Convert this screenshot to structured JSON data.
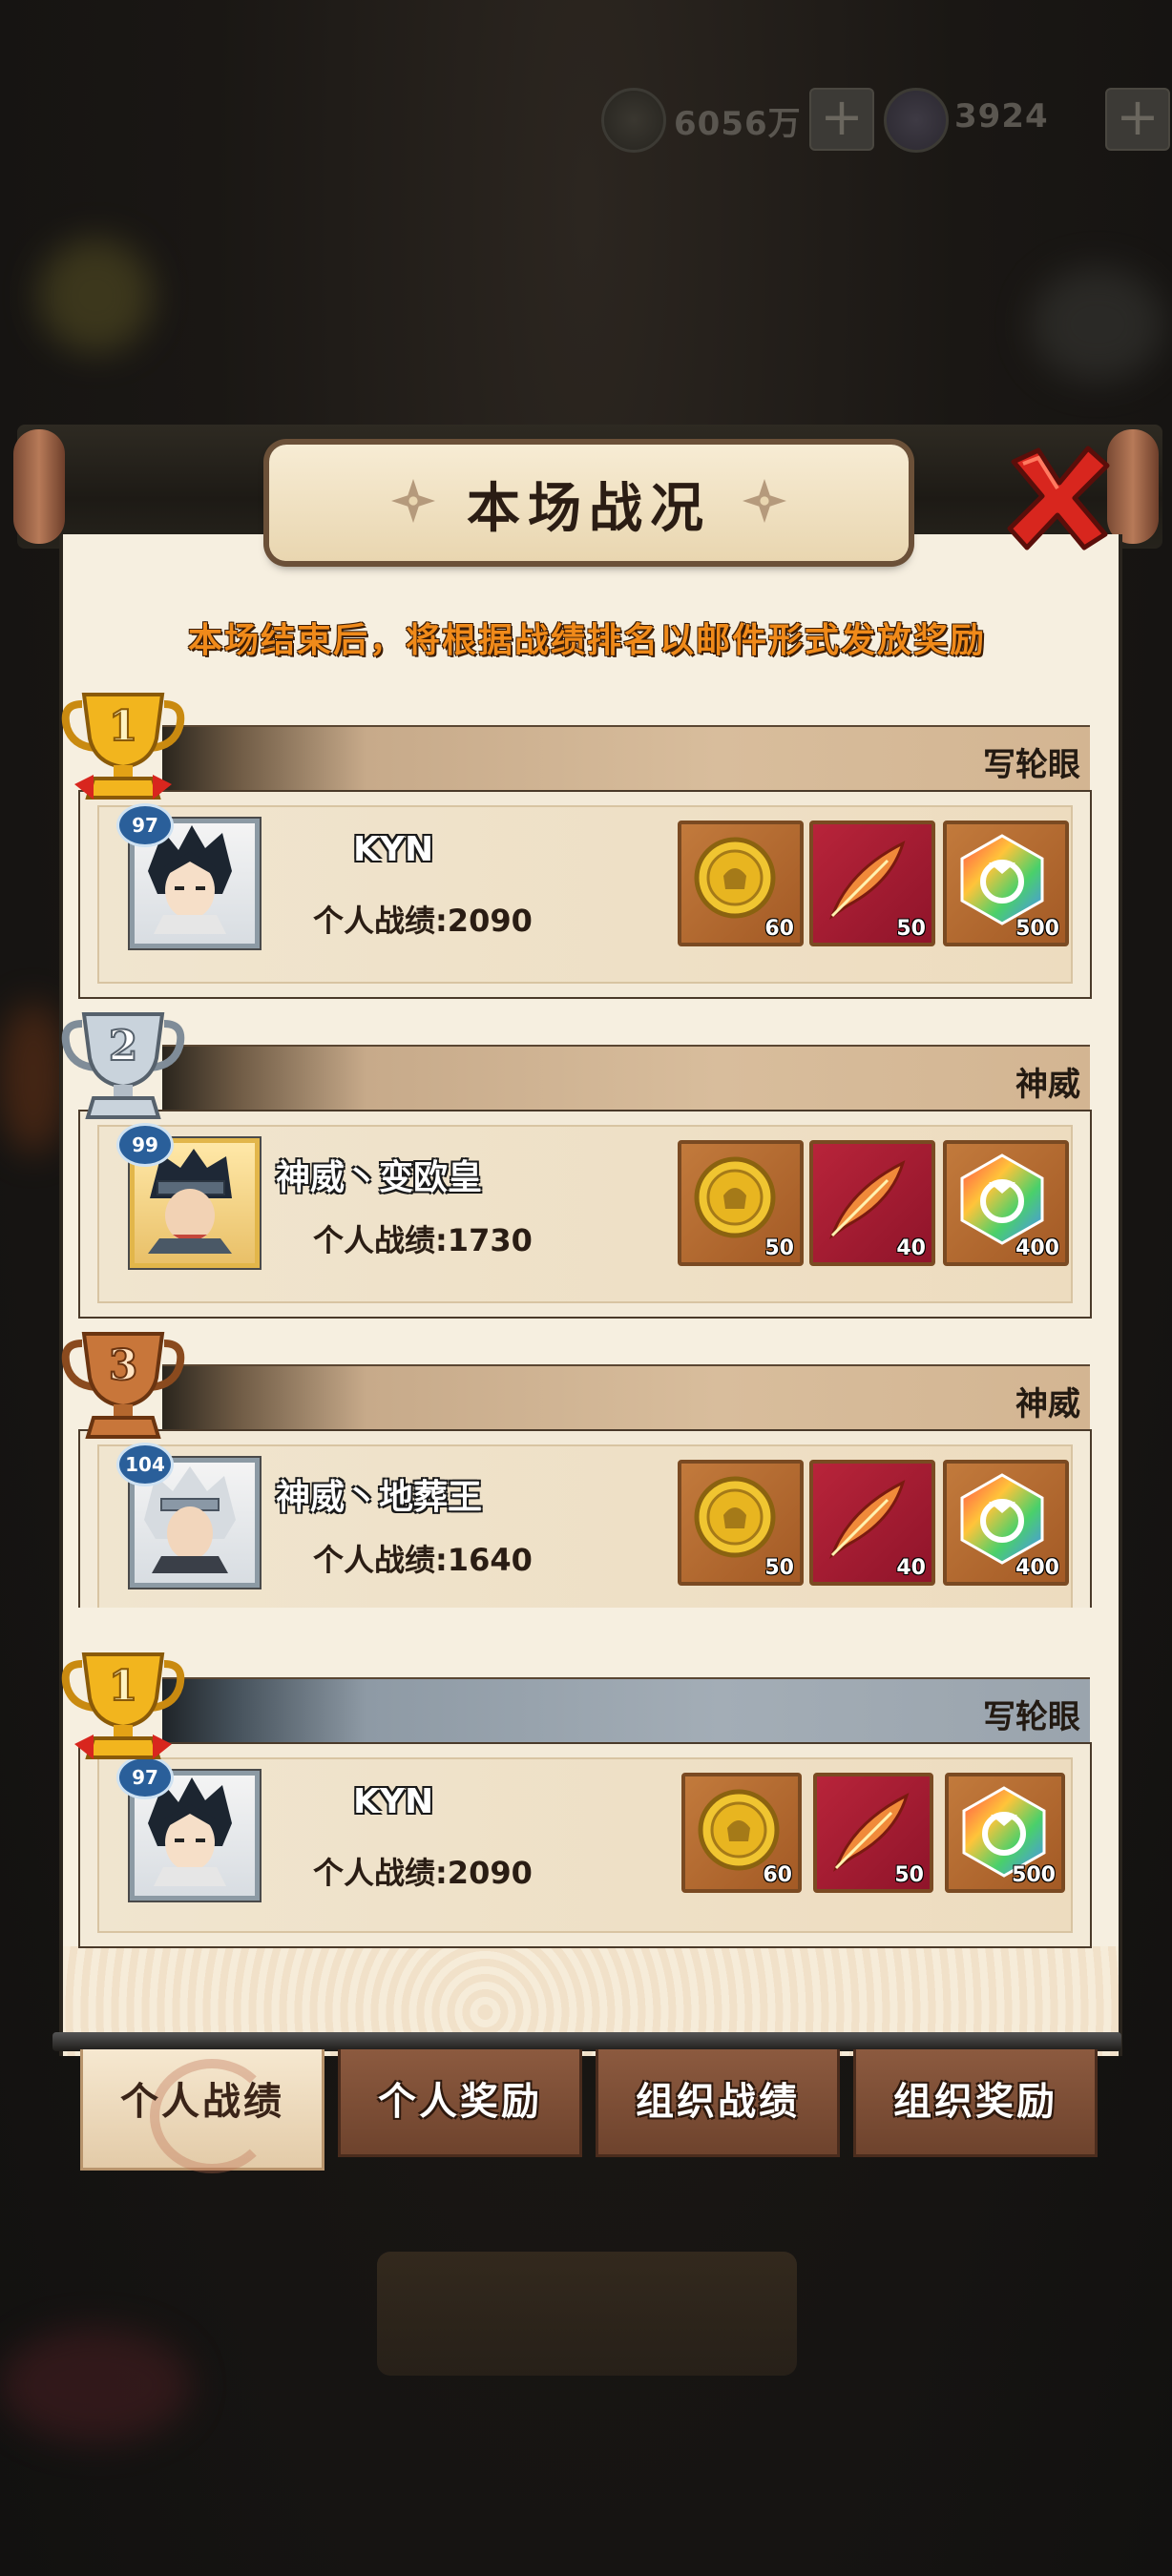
{
  "currency": {
    "coins": "6056万",
    "gems": "3924",
    "plus": "+"
  },
  "panel": {
    "title": "本场战况",
    "notice": "本场结束后，将根据战绩排名以邮件形式发放奖励"
  },
  "ranks": [
    {
      "rank": "1",
      "level": "97",
      "name": "KYN",
      "org": "写轮眼",
      "score": "个人战绩:2090",
      "rewards": [
        {
          "type": "coin-icon",
          "count": "60"
        },
        {
          "type": "feather-icon",
          "count": "50"
        },
        {
          "type": "gem-icon",
          "count": "500"
        }
      ]
    },
    {
      "rank": "2",
      "level": "99",
      "name": "神威丶变欧皇",
      "org": "神威",
      "score": "个人战绩:1730",
      "rewards": [
        {
          "type": "coin-icon",
          "count": "50"
        },
        {
          "type": "feather-icon",
          "count": "40"
        },
        {
          "type": "gem-icon",
          "count": "400"
        }
      ]
    },
    {
      "rank": "3",
      "level": "104",
      "name": "神威丶地葬王",
      "org": "神威",
      "score": "个人战绩:1640",
      "rewards": [
        {
          "type": "coin-icon",
          "count": "50"
        },
        {
          "type": "feather-icon",
          "count": "40"
        },
        {
          "type": "gem-icon",
          "count": "400"
        }
      ]
    },
    {
      "rank": "1",
      "level": "97",
      "name": "KYN",
      "org": "写轮眼",
      "score": "个人战绩:2090",
      "rewards": [
        {
          "type": "coin-icon",
          "count": "60"
        },
        {
          "type": "feather-icon",
          "count": "50"
        },
        {
          "type": "gem-icon",
          "count": "500"
        }
      ]
    }
  ],
  "tabs": [
    {
      "label": "个人战绩",
      "active": true
    },
    {
      "label": "个人奖励",
      "active": false
    },
    {
      "label": "组织战绩",
      "active": false
    },
    {
      "label": "组织奖励",
      "active": false
    }
  ],
  "colors": {
    "notice": "#f08a1a",
    "gold_trophy": "#f2b51e",
    "silver_trophy": "#c9d3dc",
    "bronze_trophy": "#c8763a"
  }
}
